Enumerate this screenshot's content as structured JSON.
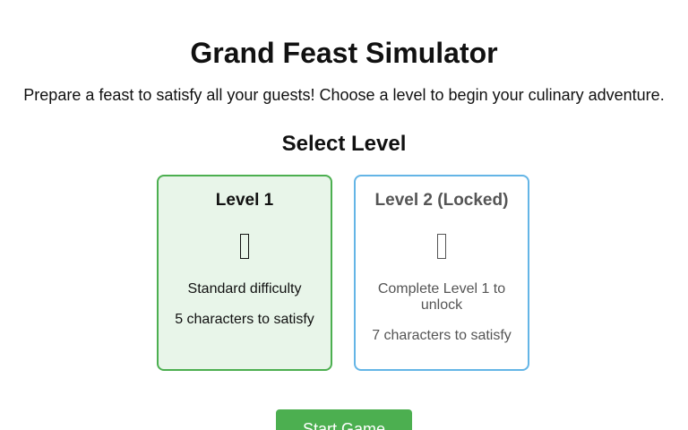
{
  "header": {
    "title": "Grand Feast Simulator",
    "subtitle": "Prepare a feast to satisfy all your guests! Choose a level to begin your culinary adventure."
  },
  "level_select": {
    "heading": "Select Level",
    "levels": [
      {
        "title": "Level 1",
        "icon": "unknown-glyph-icon",
        "description": "Standard difficulty",
        "characters": "5 characters to satisfy",
        "locked": false,
        "selected": true,
        "accent_color": "#4caf50",
        "background_color": "#e8f5e9"
      },
      {
        "title": "Level 2 (Locked)",
        "icon": "unknown-glyph-icon",
        "description": "Complete Level 1 to unlock",
        "characters": "7 characters to satisfy",
        "locked": true,
        "selected": false,
        "accent_color": "#64b5e6",
        "background_color": "#ffffff"
      }
    ]
  },
  "actions": {
    "start_label": "Start Game",
    "start_color": "#4caf50"
  }
}
